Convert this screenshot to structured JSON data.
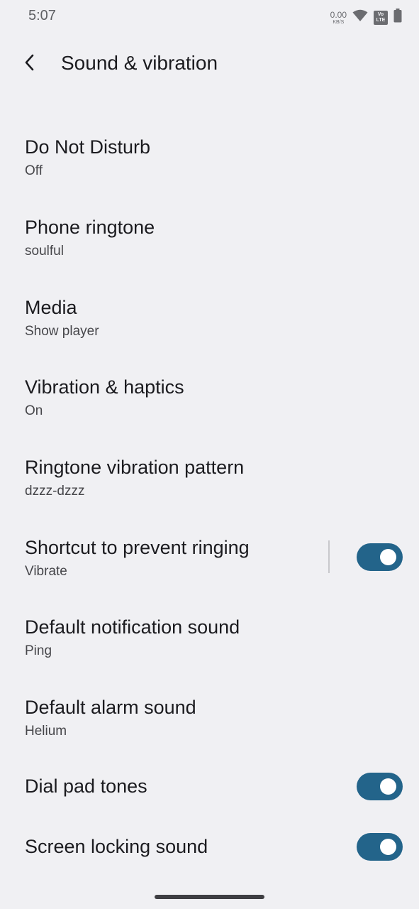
{
  "colors": {
    "background": "#f0f0f3",
    "accent": "#23648a"
  },
  "status_bar": {
    "time": "5:07",
    "net_speed_value": "0.00",
    "net_speed_unit": "KB/S",
    "volte_top": "Vo",
    "volte_bottom": "LTE",
    "icons": [
      "wifi-icon",
      "volte-icon",
      "battery-icon"
    ]
  },
  "header": {
    "title": "Sound & vibration",
    "back_icon": "back-arrow-icon"
  },
  "items": [
    {
      "title": "Do Not Disturb",
      "summary": "Off"
    },
    {
      "title": "Phone ringtone",
      "summary": "soulful"
    },
    {
      "title": "Media",
      "summary": "Show player"
    },
    {
      "title": "Vibration & haptics",
      "summary": "On"
    },
    {
      "title": "Ringtone vibration pattern",
      "summary": "dzzz-dzzz"
    },
    {
      "title": "Shortcut to prevent ringing",
      "summary": "Vibrate",
      "toggle": "on"
    },
    {
      "title": "Default notification sound",
      "summary": "Ping"
    },
    {
      "title": "Default alarm sound",
      "summary": "Helium"
    },
    {
      "title": "Dial pad tones",
      "toggle": "on"
    },
    {
      "title": "Screen locking sound",
      "toggle": "on"
    }
  ]
}
